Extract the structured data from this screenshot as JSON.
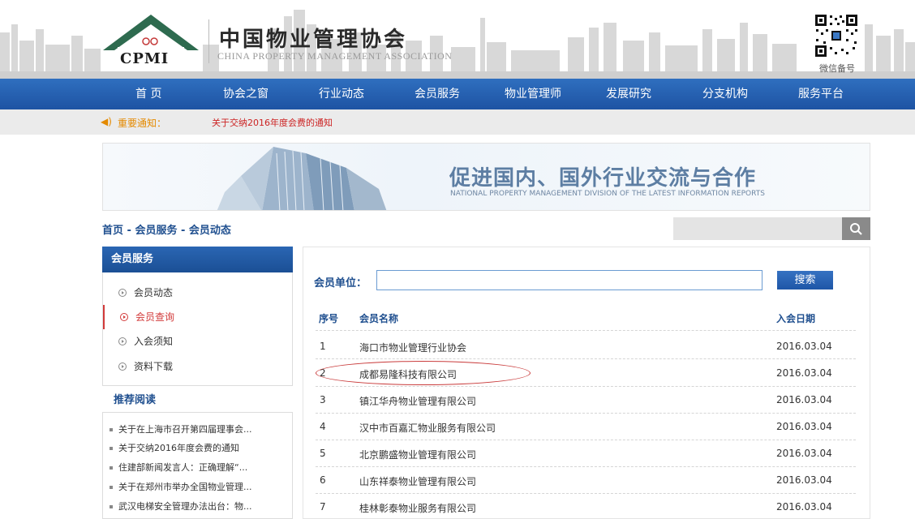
{
  "header": {
    "logo_text": "CPMI",
    "title_cn": "中国物业管理协会",
    "title_en": "CHINA PROPERTY MANAGEMENT ASSOCIATION",
    "qr_caption": "微信备号"
  },
  "nav": {
    "items": [
      "首 页",
      "协会之窗",
      "行业动态",
      "会员服务",
      "物业管理师",
      "发展研究",
      "分支机构",
      "服务平台"
    ]
  },
  "notice": {
    "label": "重要通知：",
    "text": "关于交纳2016年度会费的通知"
  },
  "banner": {
    "title": "促进国内、国外行业交流与合作",
    "subtitle": "NATIONAL PROPERTY MANAGEMENT DIVISION OF THE LATEST INFORMATION REPORTS"
  },
  "breadcrumb": "首页 - 会员服务 - 会员动态",
  "sidebar": {
    "title": "会员服务",
    "items": [
      {
        "label": "会员动态",
        "active": false
      },
      {
        "label": "会员查询",
        "active": true
      },
      {
        "label": "入会须知",
        "active": false
      },
      {
        "label": "资料下载",
        "active": false
      }
    ]
  },
  "reading": {
    "title": "推荐阅读",
    "items": [
      "关于在上海市召开第四届理事会...",
      "关于交纳2016年度会费的通知",
      "住建部新闻发言人：正确理解“...",
      "关于在郑州市举办全国物业管理...",
      "武汉电梯安全管理办法出台：物..."
    ]
  },
  "search_form": {
    "label": "会员单位：",
    "value": "",
    "button": "搜索"
  },
  "table": {
    "headers": {
      "no": "序号",
      "name": "会员名称",
      "date": "入会日期"
    },
    "rows": [
      {
        "no": "1",
        "name": "海口市物业管理行业协会",
        "date": "2016.03.04"
      },
      {
        "no": "2",
        "name": "成都易隆科技有限公司",
        "date": "2016.03.04"
      },
      {
        "no": "3",
        "name": "镇江华舟物业管理有限公司",
        "date": "2016.03.04"
      },
      {
        "no": "4",
        "name": "汉中市百嘉汇物业服务有限公司",
        "date": "2016.03.04"
      },
      {
        "no": "5",
        "name": "北京鹏盛物业管理有限公司",
        "date": "2016.03.04"
      },
      {
        "no": "6",
        "name": "山东祥泰物业管理有限公司",
        "date": "2016.03.04"
      },
      {
        "no": "7",
        "name": "桂林彰泰物业服务有限公司",
        "date": "2016.03.04"
      }
    ]
  },
  "colors": {
    "nav_blue": "#1e53a3",
    "accent_red": "#d23a3a",
    "notice_orange": "#e48a00",
    "logo_green": "#2e6b4f"
  }
}
